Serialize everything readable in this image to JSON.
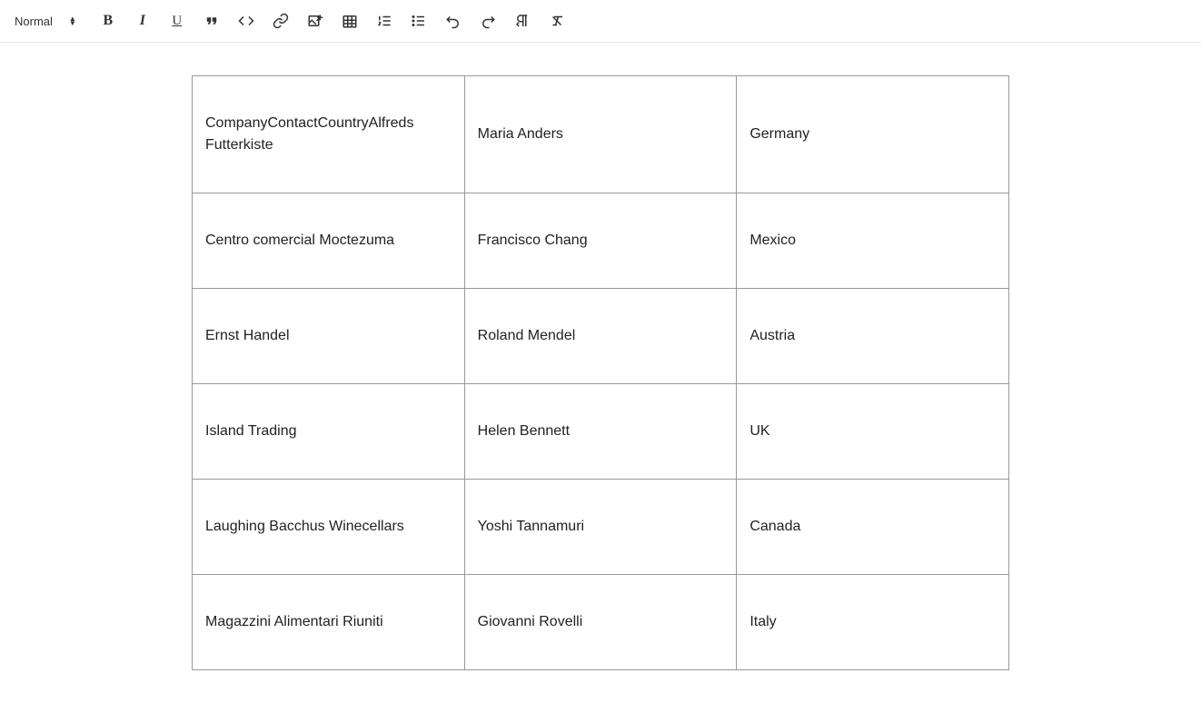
{
  "toolbar": {
    "heading": "Normal"
  },
  "table": {
    "rows": [
      {
        "c0": "CompanyContactCountryAlfreds Futterkiste",
        "c1": "Maria Anders",
        "c2": "Germany"
      },
      {
        "c0": "Centro comercial Moctezuma",
        "c1": "Francisco Chang",
        "c2": "Mexico"
      },
      {
        "c0": "Ernst Handel",
        "c1": "Roland Mendel",
        "c2": "Austria"
      },
      {
        "c0": "Island Trading",
        "c1": "Helen Bennett",
        "c2": "UK"
      },
      {
        "c0": "Laughing Bacchus Winecellars",
        "c1": "Yoshi Tannamuri",
        "c2": "Canada"
      },
      {
        "c0": "Magazzini Alimentari Riuniti",
        "c1": "Giovanni Rovelli",
        "c2": "Italy"
      }
    ]
  }
}
